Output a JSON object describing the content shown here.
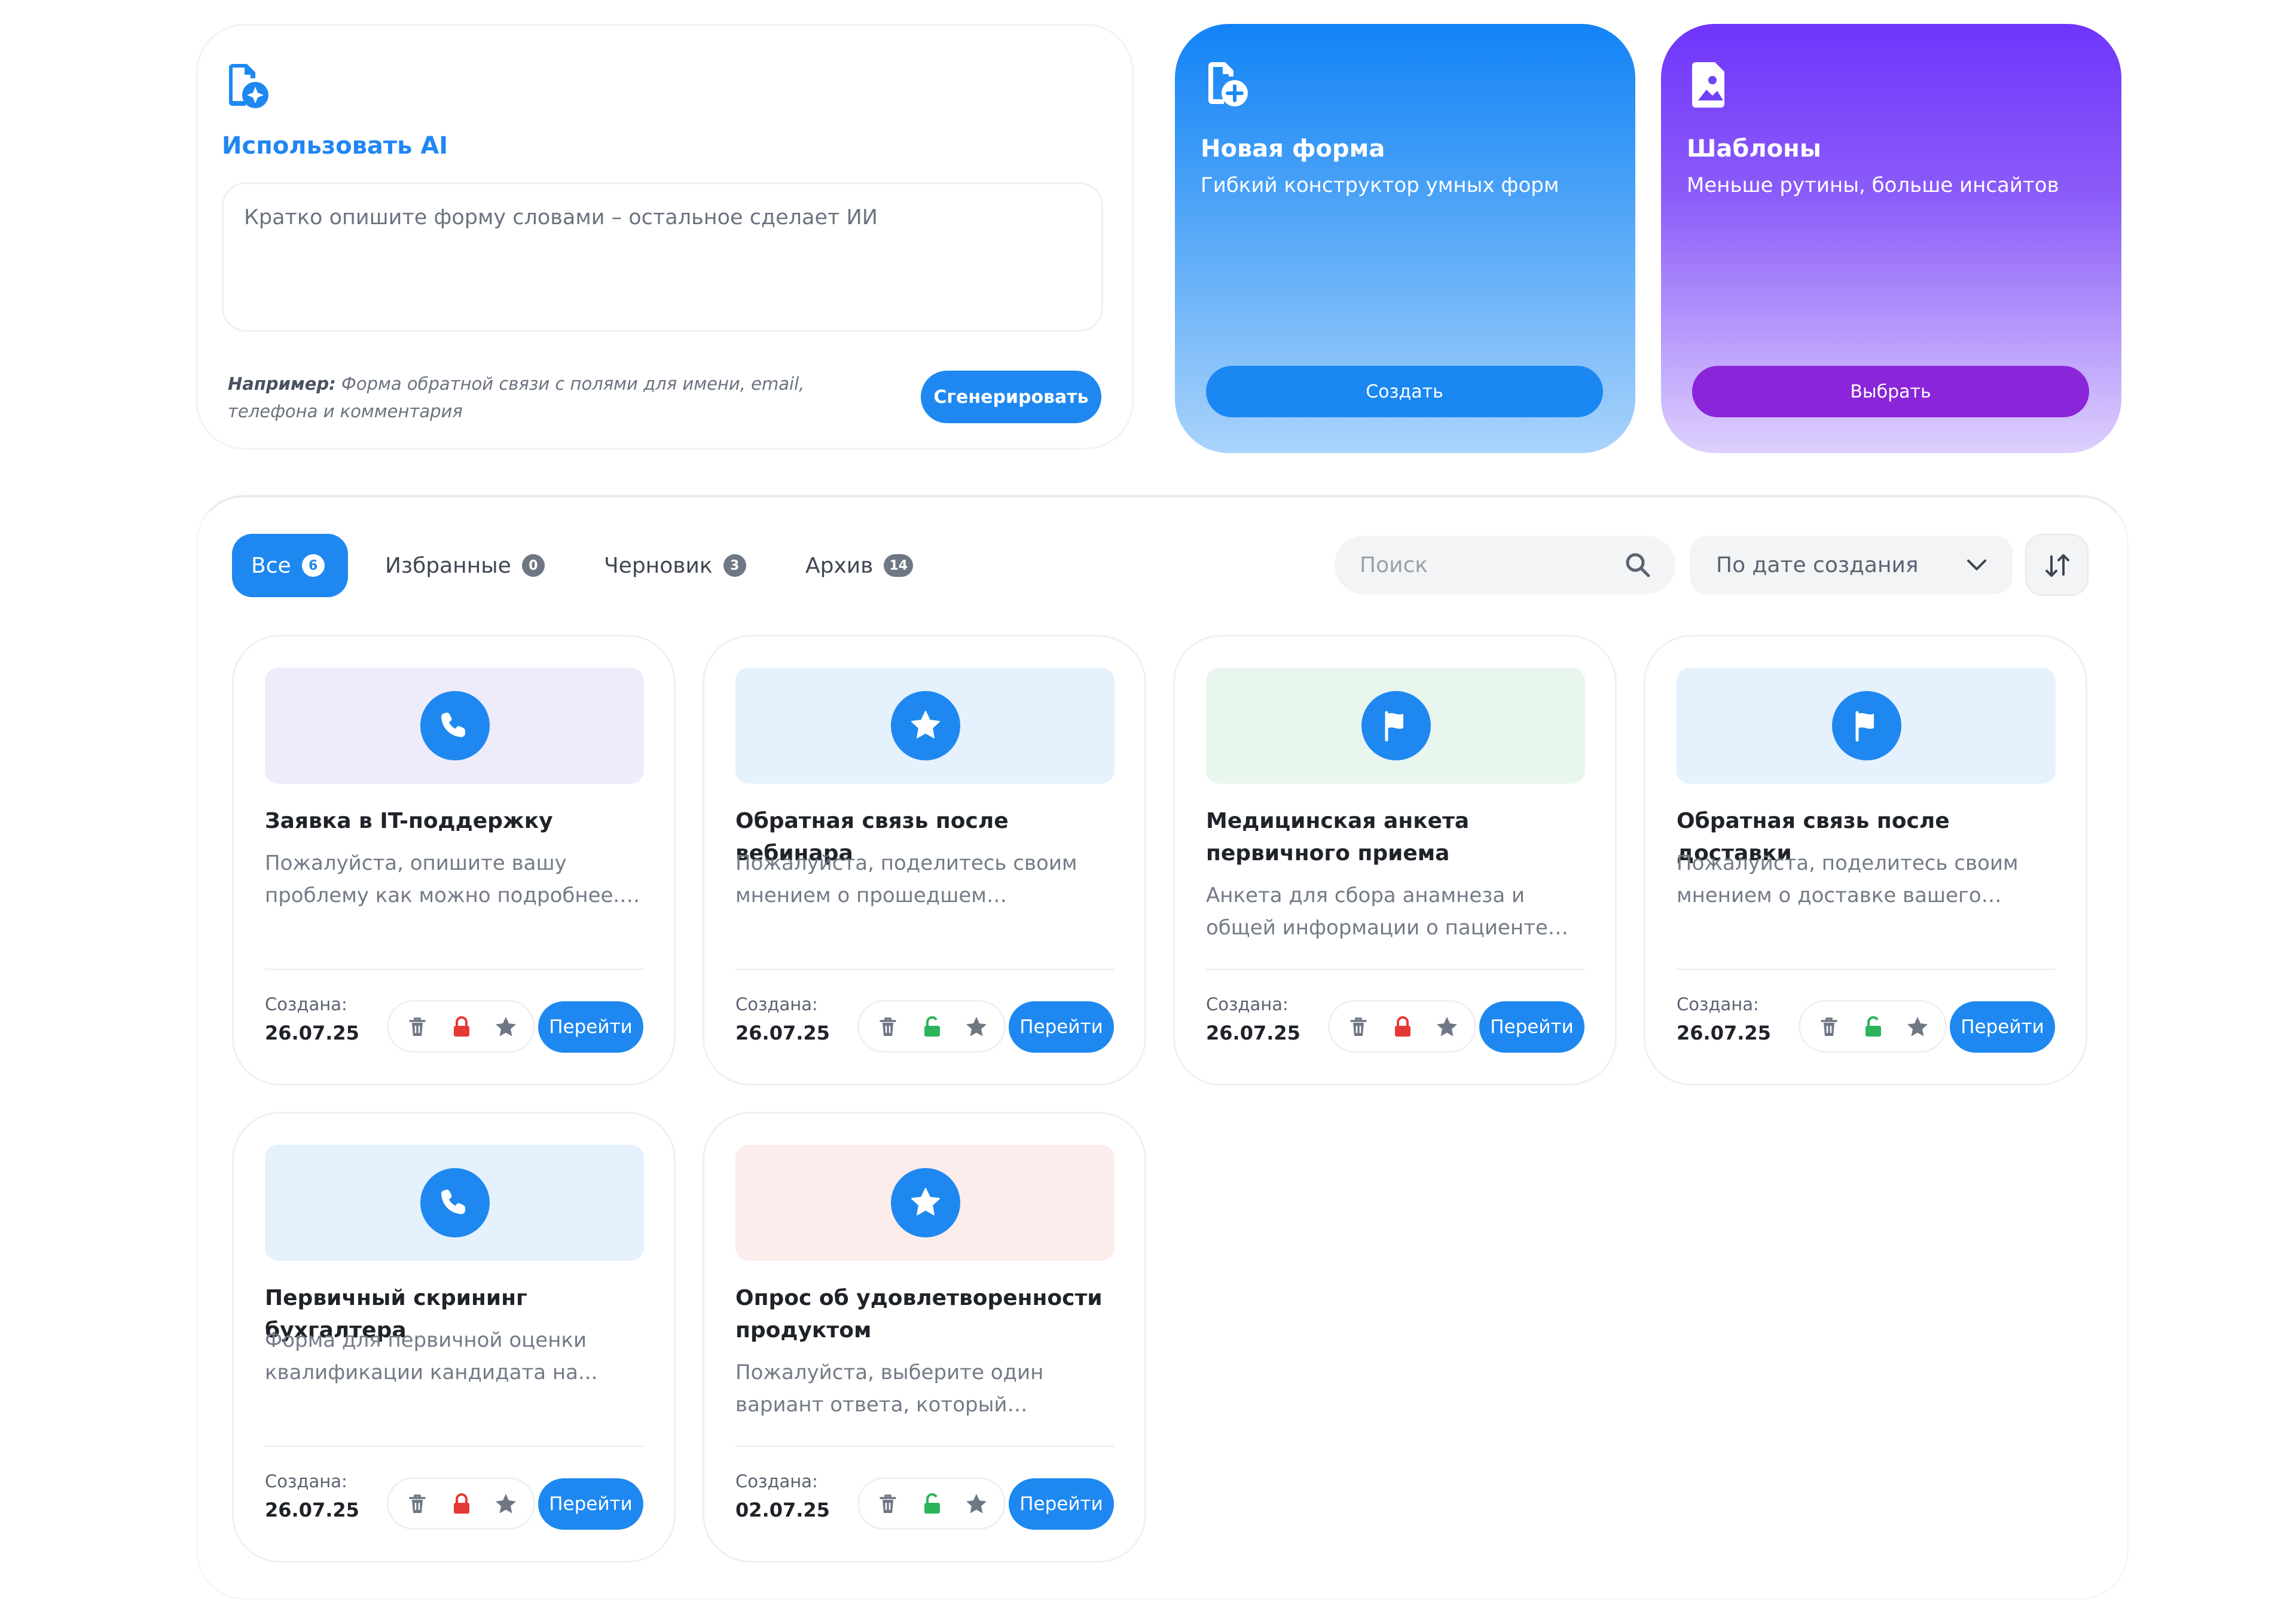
{
  "ai_panel": {
    "title": "Использовать AI",
    "placeholder": "Кратко опишите форму словами – остальное сделает ИИ",
    "example_label": "Например:",
    "example_text": " Форма обратной связи с полями для имени, email, телефона и комментария",
    "generate_label": "Сгенерировать"
  },
  "new_form_card": {
    "title": "Новая форма",
    "subtitle": "Гибкий конструктор умных форм",
    "button_label": "Создать"
  },
  "templates_card": {
    "title": "Шаблоны",
    "subtitle": "Меньше рутины, больше инсайтов",
    "button_label": "Выбрать"
  },
  "tabs": [
    {
      "label": "Все",
      "count": "6",
      "active": true
    },
    {
      "label": "Избранные",
      "count": "0",
      "active": false
    },
    {
      "label": "Черновик",
      "count": "3",
      "active": false
    },
    {
      "label": "Архив",
      "count": "14",
      "active": false
    }
  ],
  "search": {
    "placeholder": "Поиск"
  },
  "sort": {
    "selected": "По дате создания"
  },
  "created_label": "Создана:",
  "go_label": "Перейти",
  "colors": {
    "accent": "#1e88f0",
    "locked": "#e53935",
    "unlocked": "#2eb35a",
    "templates_button": "#8a25d9"
  },
  "forms": [
    {
      "title": "Заявка в IT-поддержку",
      "description": "Пожалуйста, опишите вашу проблему как можно подробнее. Эт...",
      "created": "26.07.25",
      "icon": "phone-icon",
      "cover_color": "#eeebfb",
      "locked": true
    },
    {
      "title": "Обратная связь после вебинара",
      "description": "Пожалуйста, поделитесь своим мнением о прошедшем вебинаре,...",
      "created": "26.07.25",
      "icon": "star-icon",
      "cover_color": "#e5f1fd",
      "locked": false
    },
    {
      "title": "Медицинская анкета первичного приема",
      "description": "Анкета для сбора анамнеза и общей информации о пациенте при...",
      "created": "26.07.25",
      "icon": "flag-icon",
      "cover_color": "#e9f6ee",
      "locked": true
    },
    {
      "title": "Обратная связь после доставки",
      "description": "Пожалуйста, поделитесь своим мнением о доставке вашего заказа....",
      "created": "26.07.25",
      "icon": "flag-icon",
      "cover_color": "#e5f1fd",
      "locked": false
    },
    {
      "title": "Первичный скрининг бухгалтера",
      "description": "Форма для первичной оценки квалификации кандидата на...",
      "created": "26.07.25",
      "icon": "phone-icon",
      "cover_color": "#e5f1fd",
      "locked": true
    },
    {
      "title": "Опрос об удовлетворенности продуктом",
      "description": "Пожалуйста, выберите один вариант ответа, который наилучшим образо...",
      "created": "02.07.25",
      "icon": "star-icon",
      "cover_color": "#fdecec",
      "locked": false
    }
  ]
}
